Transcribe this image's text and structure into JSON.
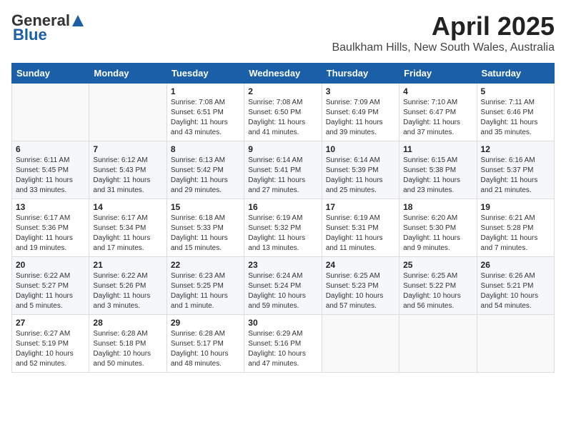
{
  "header": {
    "logo_general": "General",
    "logo_blue": "Blue",
    "title": "April 2025",
    "subtitle": "Baulkham Hills, New South Wales, Australia"
  },
  "days_of_week": [
    "Sunday",
    "Monday",
    "Tuesday",
    "Wednesday",
    "Thursday",
    "Friday",
    "Saturday"
  ],
  "weeks": [
    [
      {
        "day": "",
        "sunrise": "",
        "sunset": "",
        "daylight": ""
      },
      {
        "day": "",
        "sunrise": "",
        "sunset": "",
        "daylight": ""
      },
      {
        "day": "1",
        "sunrise": "Sunrise: 7:08 AM",
        "sunset": "Sunset: 6:51 PM",
        "daylight": "Daylight: 11 hours and 43 minutes."
      },
      {
        "day": "2",
        "sunrise": "Sunrise: 7:08 AM",
        "sunset": "Sunset: 6:50 PM",
        "daylight": "Daylight: 11 hours and 41 minutes."
      },
      {
        "day": "3",
        "sunrise": "Sunrise: 7:09 AM",
        "sunset": "Sunset: 6:49 PM",
        "daylight": "Daylight: 11 hours and 39 minutes."
      },
      {
        "day": "4",
        "sunrise": "Sunrise: 7:10 AM",
        "sunset": "Sunset: 6:47 PM",
        "daylight": "Daylight: 11 hours and 37 minutes."
      },
      {
        "day": "5",
        "sunrise": "Sunrise: 7:11 AM",
        "sunset": "Sunset: 6:46 PM",
        "daylight": "Daylight: 11 hours and 35 minutes."
      }
    ],
    [
      {
        "day": "6",
        "sunrise": "Sunrise: 6:11 AM",
        "sunset": "Sunset: 5:45 PM",
        "daylight": "Daylight: 11 hours and 33 minutes."
      },
      {
        "day": "7",
        "sunrise": "Sunrise: 6:12 AM",
        "sunset": "Sunset: 5:43 PM",
        "daylight": "Daylight: 11 hours and 31 minutes."
      },
      {
        "day": "8",
        "sunrise": "Sunrise: 6:13 AM",
        "sunset": "Sunset: 5:42 PM",
        "daylight": "Daylight: 11 hours and 29 minutes."
      },
      {
        "day": "9",
        "sunrise": "Sunrise: 6:14 AM",
        "sunset": "Sunset: 5:41 PM",
        "daylight": "Daylight: 11 hours and 27 minutes."
      },
      {
        "day": "10",
        "sunrise": "Sunrise: 6:14 AM",
        "sunset": "Sunset: 5:39 PM",
        "daylight": "Daylight: 11 hours and 25 minutes."
      },
      {
        "day": "11",
        "sunrise": "Sunrise: 6:15 AM",
        "sunset": "Sunset: 5:38 PM",
        "daylight": "Daylight: 11 hours and 23 minutes."
      },
      {
        "day": "12",
        "sunrise": "Sunrise: 6:16 AM",
        "sunset": "Sunset: 5:37 PM",
        "daylight": "Daylight: 11 hours and 21 minutes."
      }
    ],
    [
      {
        "day": "13",
        "sunrise": "Sunrise: 6:17 AM",
        "sunset": "Sunset: 5:36 PM",
        "daylight": "Daylight: 11 hours and 19 minutes."
      },
      {
        "day": "14",
        "sunrise": "Sunrise: 6:17 AM",
        "sunset": "Sunset: 5:34 PM",
        "daylight": "Daylight: 11 hours and 17 minutes."
      },
      {
        "day": "15",
        "sunrise": "Sunrise: 6:18 AM",
        "sunset": "Sunset: 5:33 PM",
        "daylight": "Daylight: 11 hours and 15 minutes."
      },
      {
        "day": "16",
        "sunrise": "Sunrise: 6:19 AM",
        "sunset": "Sunset: 5:32 PM",
        "daylight": "Daylight: 11 hours and 13 minutes."
      },
      {
        "day": "17",
        "sunrise": "Sunrise: 6:19 AM",
        "sunset": "Sunset: 5:31 PM",
        "daylight": "Daylight: 11 hours and 11 minutes."
      },
      {
        "day": "18",
        "sunrise": "Sunrise: 6:20 AM",
        "sunset": "Sunset: 5:30 PM",
        "daylight": "Daylight: 11 hours and 9 minutes."
      },
      {
        "day": "19",
        "sunrise": "Sunrise: 6:21 AM",
        "sunset": "Sunset: 5:28 PM",
        "daylight": "Daylight: 11 hours and 7 minutes."
      }
    ],
    [
      {
        "day": "20",
        "sunrise": "Sunrise: 6:22 AM",
        "sunset": "Sunset: 5:27 PM",
        "daylight": "Daylight: 11 hours and 5 minutes."
      },
      {
        "day": "21",
        "sunrise": "Sunrise: 6:22 AM",
        "sunset": "Sunset: 5:26 PM",
        "daylight": "Daylight: 11 hours and 3 minutes."
      },
      {
        "day": "22",
        "sunrise": "Sunrise: 6:23 AM",
        "sunset": "Sunset: 5:25 PM",
        "daylight": "Daylight: 11 hours and 1 minute."
      },
      {
        "day": "23",
        "sunrise": "Sunrise: 6:24 AM",
        "sunset": "Sunset: 5:24 PM",
        "daylight": "Daylight: 10 hours and 59 minutes."
      },
      {
        "day": "24",
        "sunrise": "Sunrise: 6:25 AM",
        "sunset": "Sunset: 5:23 PM",
        "daylight": "Daylight: 10 hours and 57 minutes."
      },
      {
        "day": "25",
        "sunrise": "Sunrise: 6:25 AM",
        "sunset": "Sunset: 5:22 PM",
        "daylight": "Daylight: 10 hours and 56 minutes."
      },
      {
        "day": "26",
        "sunrise": "Sunrise: 6:26 AM",
        "sunset": "Sunset: 5:21 PM",
        "daylight": "Daylight: 10 hours and 54 minutes."
      }
    ],
    [
      {
        "day": "27",
        "sunrise": "Sunrise: 6:27 AM",
        "sunset": "Sunset: 5:19 PM",
        "daylight": "Daylight: 10 hours and 52 minutes."
      },
      {
        "day": "28",
        "sunrise": "Sunrise: 6:28 AM",
        "sunset": "Sunset: 5:18 PM",
        "daylight": "Daylight: 10 hours and 50 minutes."
      },
      {
        "day": "29",
        "sunrise": "Sunrise: 6:28 AM",
        "sunset": "Sunset: 5:17 PM",
        "daylight": "Daylight: 10 hours and 48 minutes."
      },
      {
        "day": "30",
        "sunrise": "Sunrise: 6:29 AM",
        "sunset": "Sunset: 5:16 PM",
        "daylight": "Daylight: 10 hours and 47 minutes."
      },
      {
        "day": "",
        "sunrise": "",
        "sunset": "",
        "daylight": ""
      },
      {
        "day": "",
        "sunrise": "",
        "sunset": "",
        "daylight": ""
      },
      {
        "day": "",
        "sunrise": "",
        "sunset": "",
        "daylight": ""
      }
    ]
  ]
}
